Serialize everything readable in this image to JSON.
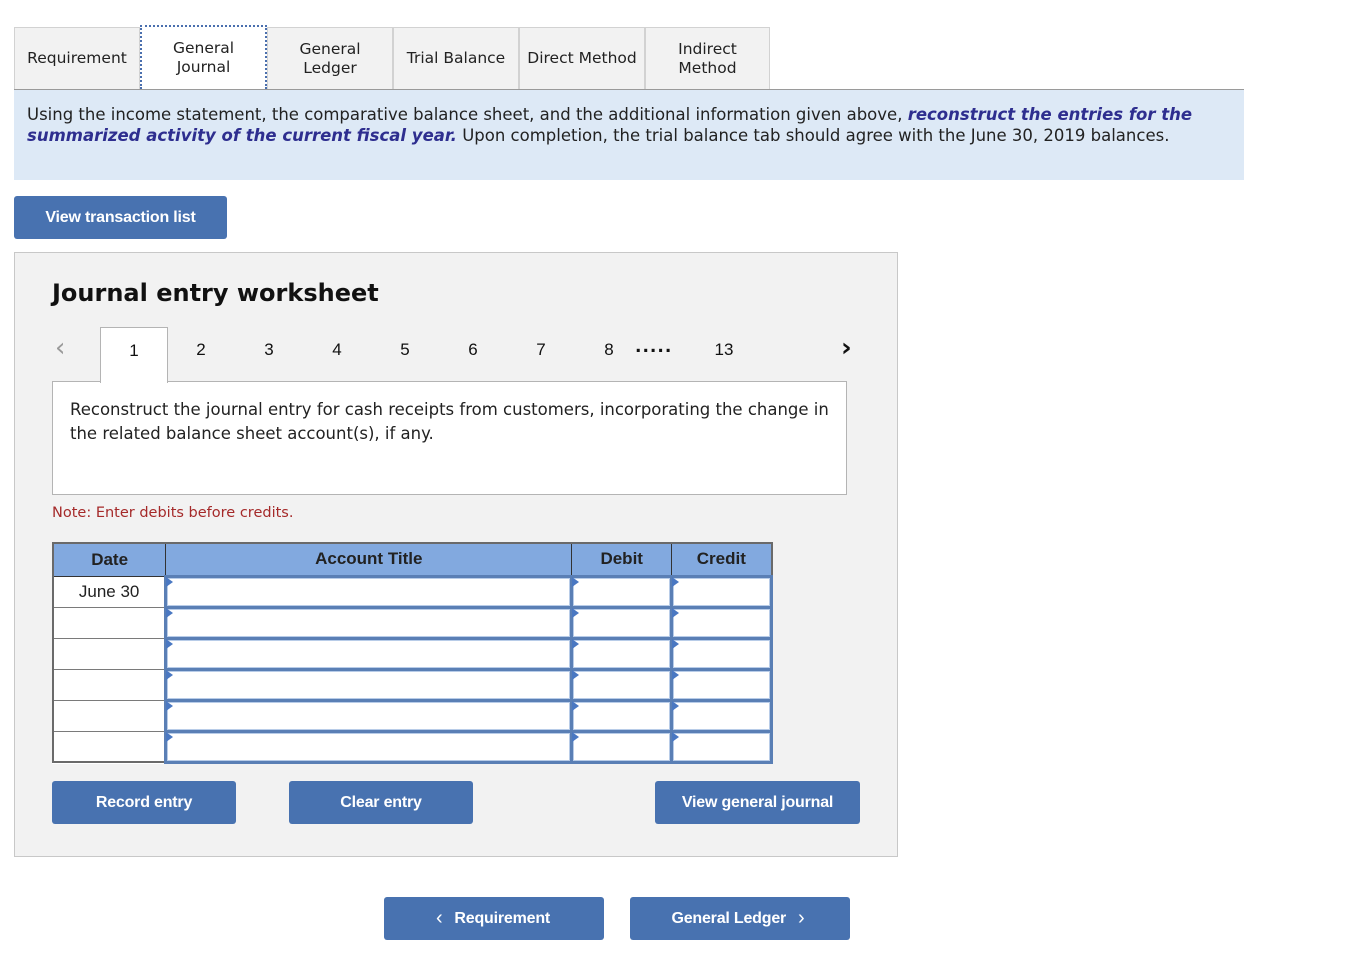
{
  "tabs": [
    {
      "label": "Requirement",
      "active": false
    },
    {
      "label": "General\nJournal",
      "active": true
    },
    {
      "label": "General\nLedger",
      "active": false
    },
    {
      "label": "Trial Balance",
      "active": false
    },
    {
      "label": "Direct Method",
      "active": false
    },
    {
      "label": "Indirect\nMethod",
      "active": false
    }
  ],
  "instructions": {
    "text_before": "Using the income statement, the comparative balance sheet, and the additional information given above, ",
    "emphasis": "reconstruct the entries for the summarized activity of the current fiscal year.",
    "text_after": " Upon completion, the trial balance tab should agree with the June 30, 2019 balances."
  },
  "view_transaction_list_label": "View transaction list",
  "worksheet": {
    "title": "Journal entry worksheet",
    "prev_icon": "chevron-left-icon",
    "next_icon": "chevron-right-icon",
    "pages": [
      "1",
      "2",
      "3",
      "4",
      "5",
      "6",
      "7",
      "8",
      "13"
    ],
    "active_page": "1",
    "ellipsis": ".....",
    "question": "Reconstruct the journal entry for cash receipts from customers, incorporating the change in the related balance sheet account(s), if any.",
    "note": "Note: Enter debits before credits.",
    "table": {
      "headers": [
        "Date",
        "Account Title",
        "Debit",
        "Credit"
      ],
      "rows": [
        {
          "date": "June 30",
          "account": "",
          "debit": "",
          "credit": ""
        },
        {
          "date": "",
          "account": "",
          "debit": "",
          "credit": ""
        },
        {
          "date": "",
          "account": "",
          "debit": "",
          "credit": ""
        },
        {
          "date": "",
          "account": "",
          "debit": "",
          "credit": ""
        },
        {
          "date": "",
          "account": "",
          "debit": "",
          "credit": ""
        },
        {
          "date": "",
          "account": "",
          "debit": "",
          "credit": ""
        }
      ]
    },
    "record_entry_label": "Record entry",
    "clear_entry_label": "Clear entry",
    "view_general_journal_label": "View general journal"
  },
  "nav": {
    "prev_label": "Requirement",
    "next_label": "General Ledger",
    "prev_icon": "‹",
    "next_icon": "›"
  },
  "colors": {
    "button_blue": "#4872b0",
    "header_blue": "#82a9df",
    "info_bg": "#dde9f6",
    "emphasis": "#2e2e8f",
    "note_red": "#a52a2a"
  }
}
